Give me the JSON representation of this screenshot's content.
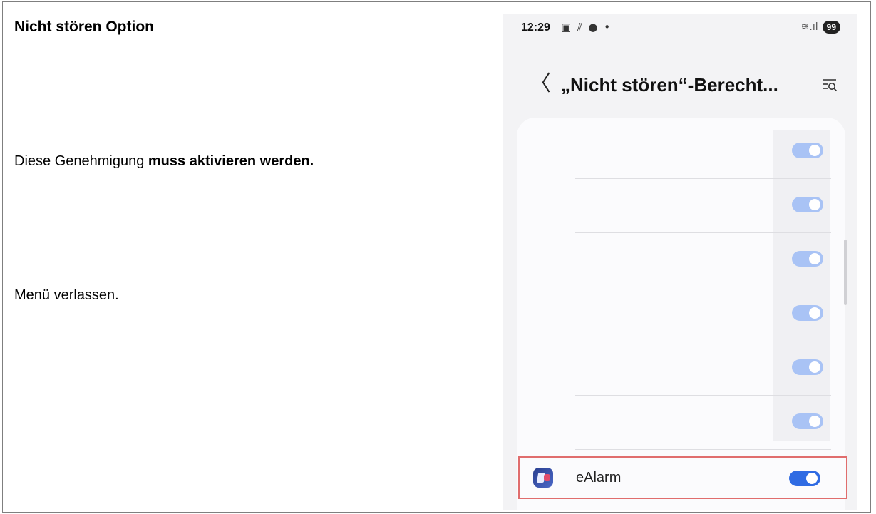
{
  "doc": {
    "heading": "Nicht stören Option",
    "line1_normal": "Diese Genehmigung ",
    "line1_bold": "muss aktivieren werden.",
    "line2": "Menü verlassen."
  },
  "phone": {
    "status": {
      "time": "12:29",
      "left_icons": "▣ ⫽ ● •",
      "wifi_icon": "≋.ıl",
      "battery": "99"
    },
    "app_bar": {
      "back_icon": "〈",
      "title": "„Nicht stören“-Berecht..."
    },
    "rows": [
      {
        "toggle_on": true
      },
      {
        "toggle_on": true
      },
      {
        "toggle_on": true
      },
      {
        "toggle_on": true
      },
      {
        "toggle_on": true
      },
      {
        "toggle_on": true
      }
    ],
    "highlighted_row": {
      "app_name": "eAlarm",
      "toggle_on": true
    }
  },
  "colors": {
    "toggle_light": "#a9c3f5",
    "toggle_active": "#2f6be3",
    "highlight_border": "#e06d6d"
  }
}
